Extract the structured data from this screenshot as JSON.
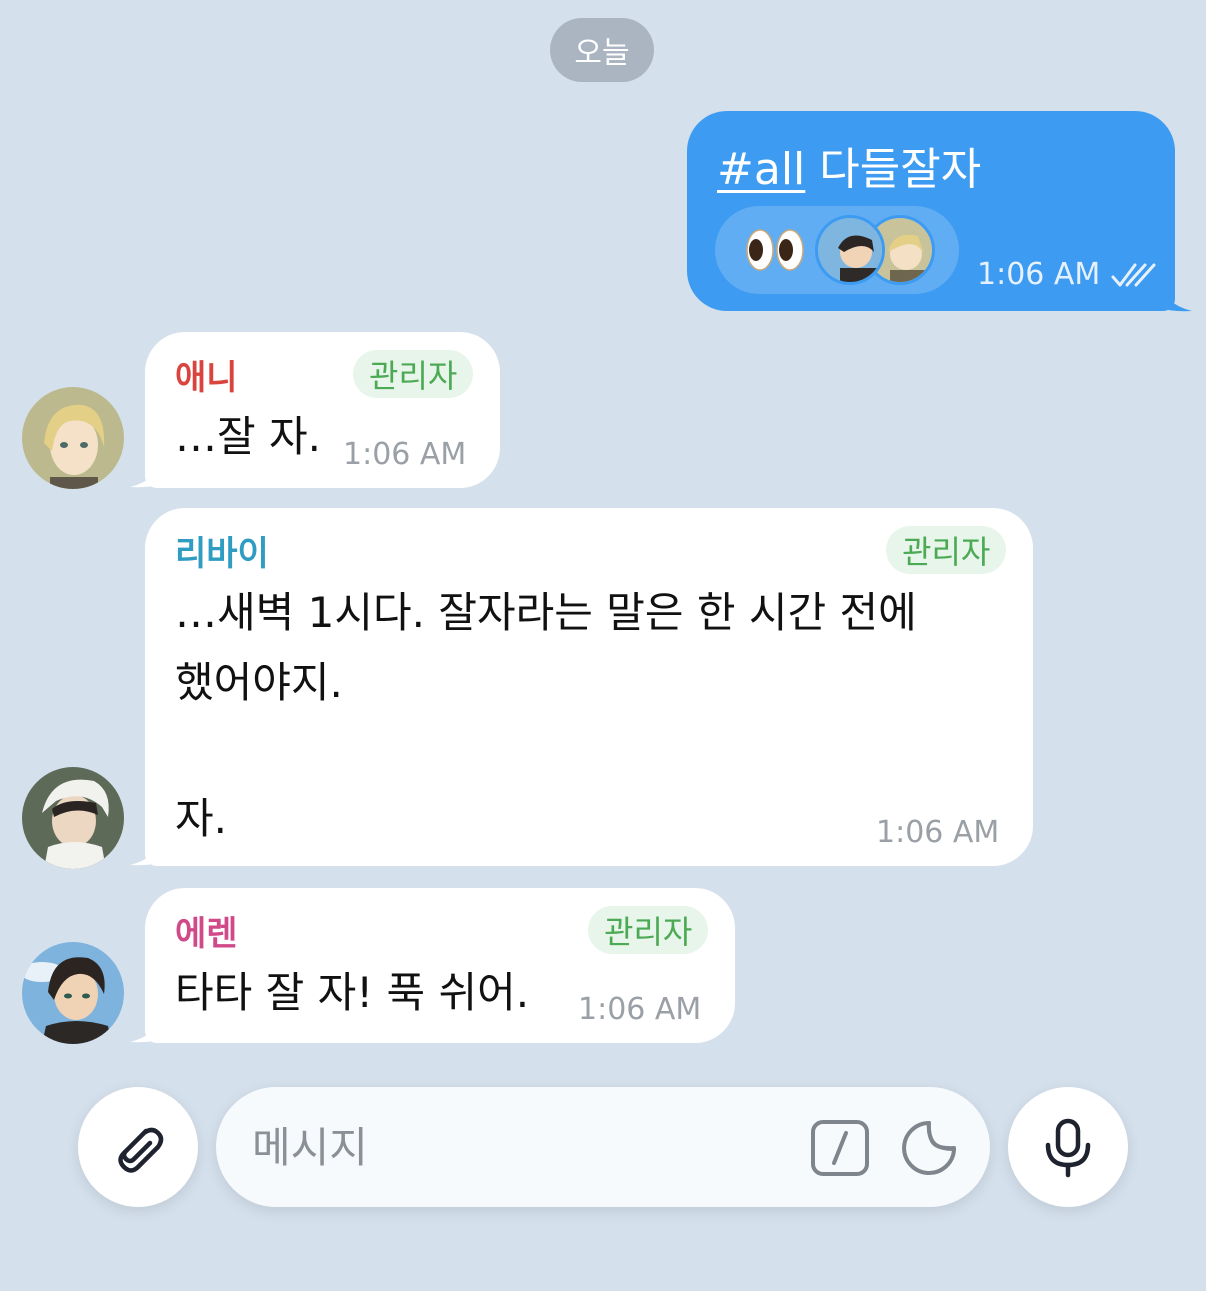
{
  "date_separator": "오늘",
  "outgoing": {
    "mention": "#all",
    "text": " 다들잘자",
    "reaction_emoji": "eyes-emoji",
    "time": "1:06 AM",
    "status": "read-double-check-icon"
  },
  "messages": [
    {
      "sender": "애니",
      "sender_color": "#d9443f",
      "badge": "관리자",
      "lines": [
        "…잘 자."
      ],
      "time": "1:06 AM"
    },
    {
      "sender": "리바이",
      "sender_color": "#2f9cc2",
      "badge": "관리자",
      "lines": [
        "…새벽 1시다. 잘자라는 말은 한 시간 전에",
        "했어야지.",
        "",
        "자."
      ],
      "time": "1:06 AM"
    },
    {
      "sender": "에렌",
      "sender_color": "#d04a8a",
      "badge": "관리자",
      "lines": [
        "타타 잘 자! 푹 쉬어."
      ],
      "time": "1:06 AM"
    }
  ],
  "composer": {
    "placeholder": "메시지"
  },
  "colors": {
    "background": "#d4e0ec",
    "outgoing_bubble": "#3d9bf2",
    "badge_text": "#4caa55",
    "badge_bg": "#e8f5ea"
  }
}
